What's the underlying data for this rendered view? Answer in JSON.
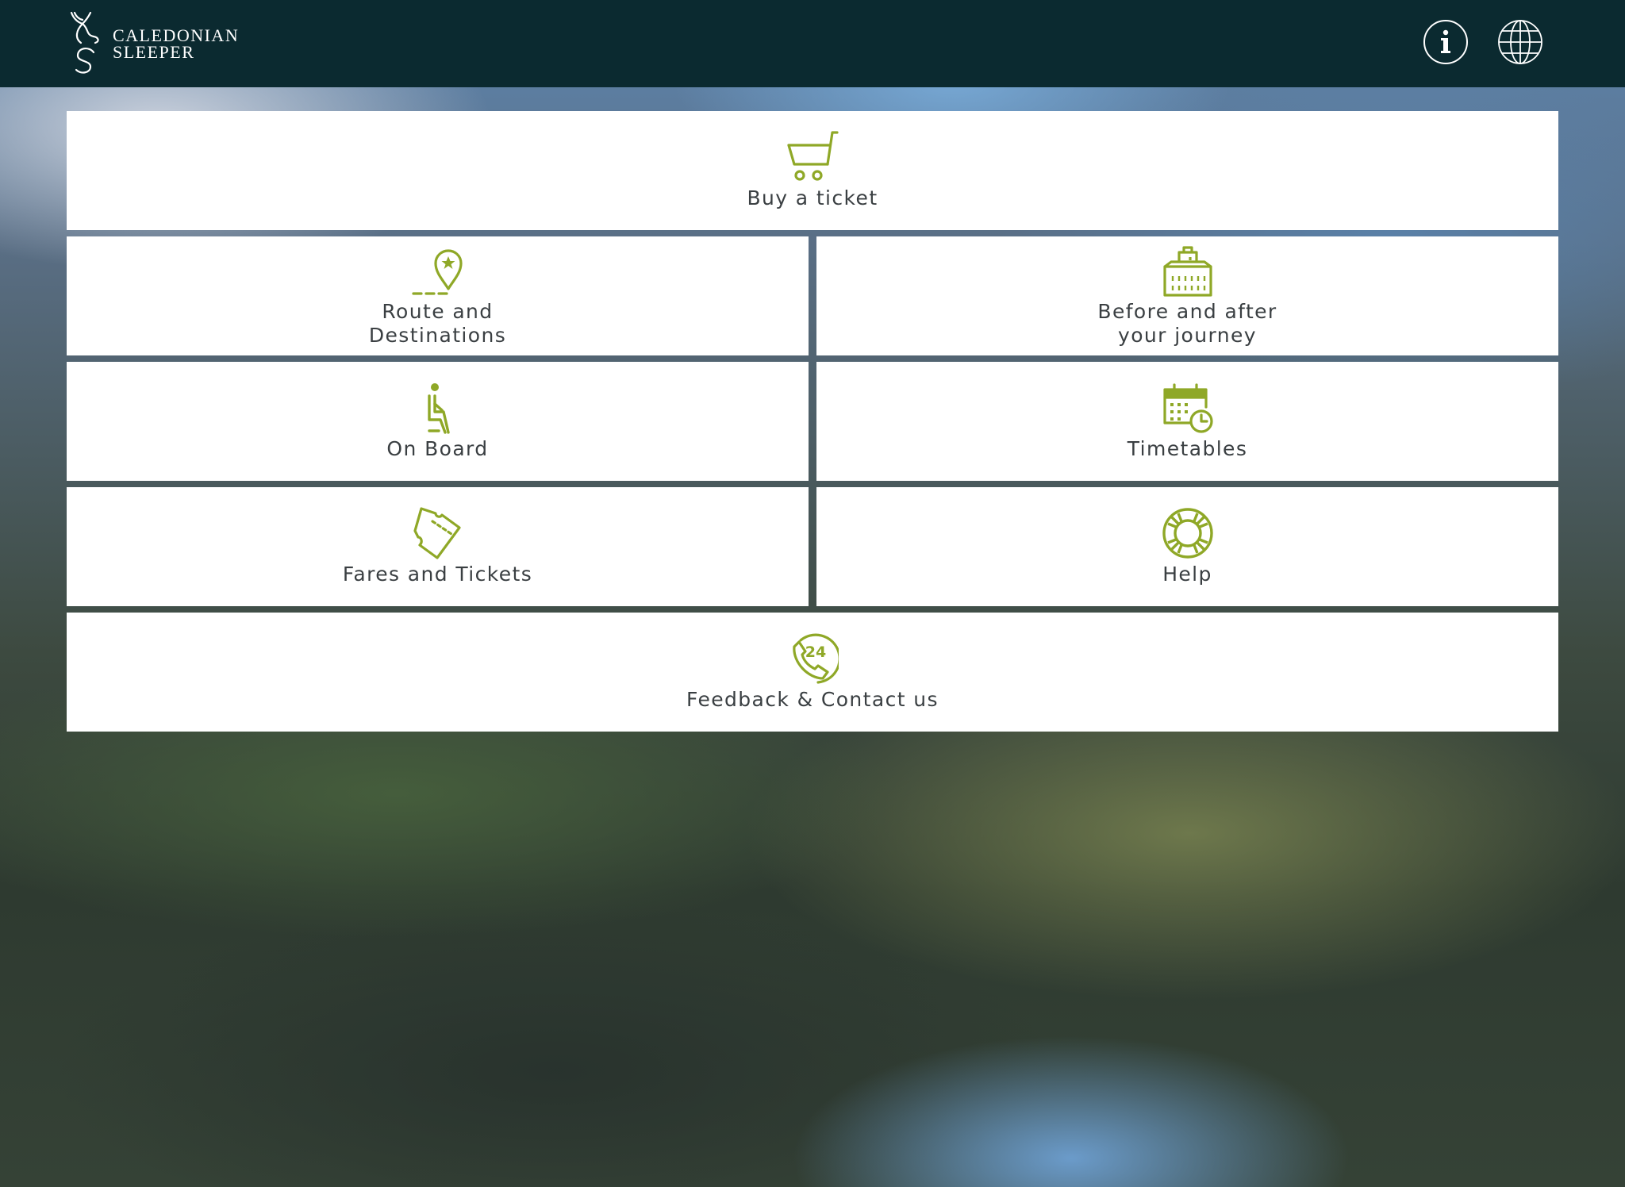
{
  "header": {
    "logo": {
      "line1": "CALEDONIAN",
      "line2": "SLEEPER",
      "icon": "stag-s-logo-icon"
    },
    "info_icon": "info-icon",
    "language_icon": "globe-icon"
  },
  "tiles": {
    "buy": {
      "label": "Buy a ticket",
      "icon": "cart-icon"
    },
    "route": {
      "label_line1": "Route and",
      "label_line2": "Destinations",
      "icon": "map-pin-icon"
    },
    "before_after": {
      "label_line1": "Before and after",
      "label_line2": "your journey",
      "icon": "building-icon"
    },
    "onboard": {
      "label": "On Board",
      "icon": "seated-person-icon"
    },
    "timetables": {
      "label": "Timetables",
      "icon": "calendar-clock-icon"
    },
    "fares": {
      "label": "Fares and Tickets",
      "icon": "ticket-icon"
    },
    "help": {
      "label": "Help",
      "icon": "lifebuoy-icon"
    },
    "feedback": {
      "label": "Feedback & Contact us",
      "icon": "phone-24-icon",
      "badge": "24"
    }
  },
  "colors": {
    "header_bg": "#0b2a30",
    "accent": "#8fa827",
    "tile_bg": "#ffffff",
    "label_text": "#3a3f42"
  }
}
